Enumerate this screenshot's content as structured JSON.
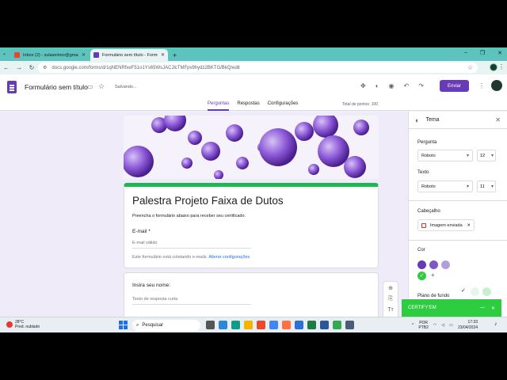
{
  "browser": {
    "tabs": [
      {
        "title": "Inbox (2) - sulaseimor@gmail...",
        "active": false
      },
      {
        "title": "Formulário sem título - Formu...",
        "active": true
      }
    ],
    "new_tab": "+",
    "url": "docs.google.com/forms/d/1qNENRfxeF51o1Ys65WsJACJlcTMFpv9hydz2BKTG/BkQ/edit",
    "window_controls": [
      "–",
      "❐",
      "✕"
    ]
  },
  "forms_header": {
    "doc_title": "Formulário sem título",
    "save_status": "Salvando...",
    "send_label": "Enviar",
    "tabs": [
      "Perguntas",
      "Respostas",
      "Configurações"
    ],
    "active_tab": "Perguntas",
    "total_points": "Total de pontos: 100"
  },
  "form": {
    "title": "Palestra Projeto Faixa de Dutos",
    "description": "Preencha o formulário abaixo para receber seu certificado.",
    "email_label": "E-mail *",
    "email_placeholder": "E-mail válido",
    "email_note": "Este formulário está coletando e-mails.",
    "email_note_link": "Alterar configurações",
    "question2_label": "Insira seu nome:",
    "question2_placeholder": "Texto de resposta curta",
    "accent_color": "#1eb853"
  },
  "floating_toolbar": [
    "add-question-icon",
    "import-icon",
    "title-icon",
    "image-icon",
    "video-icon",
    "section-icon"
  ],
  "theme_panel": {
    "title": "Tema",
    "question_label": "Pergunta",
    "question_font": "Roboto",
    "question_size": "12",
    "text_label": "Texto",
    "text_font": "Roboto",
    "text_size": "11",
    "header_label": "Cabeçalho",
    "header_chip": "Imagem enviada",
    "color_label": "Cor",
    "colors": [
      "#673ab7",
      "#7e57c2",
      "#b39ddb",
      "#2ecc40"
    ],
    "background_label": "Plano de fundo"
  },
  "toast": {
    "text": "CERTIFY'EM"
  },
  "taskbar": {
    "weather_temp": "28°C",
    "weather_desc": "Pred. nublado",
    "search_placeholder": "Pesquisar",
    "language_line1": "POR",
    "language_line2": "PTB2",
    "time": "17:33",
    "date": "23/04/2024"
  }
}
